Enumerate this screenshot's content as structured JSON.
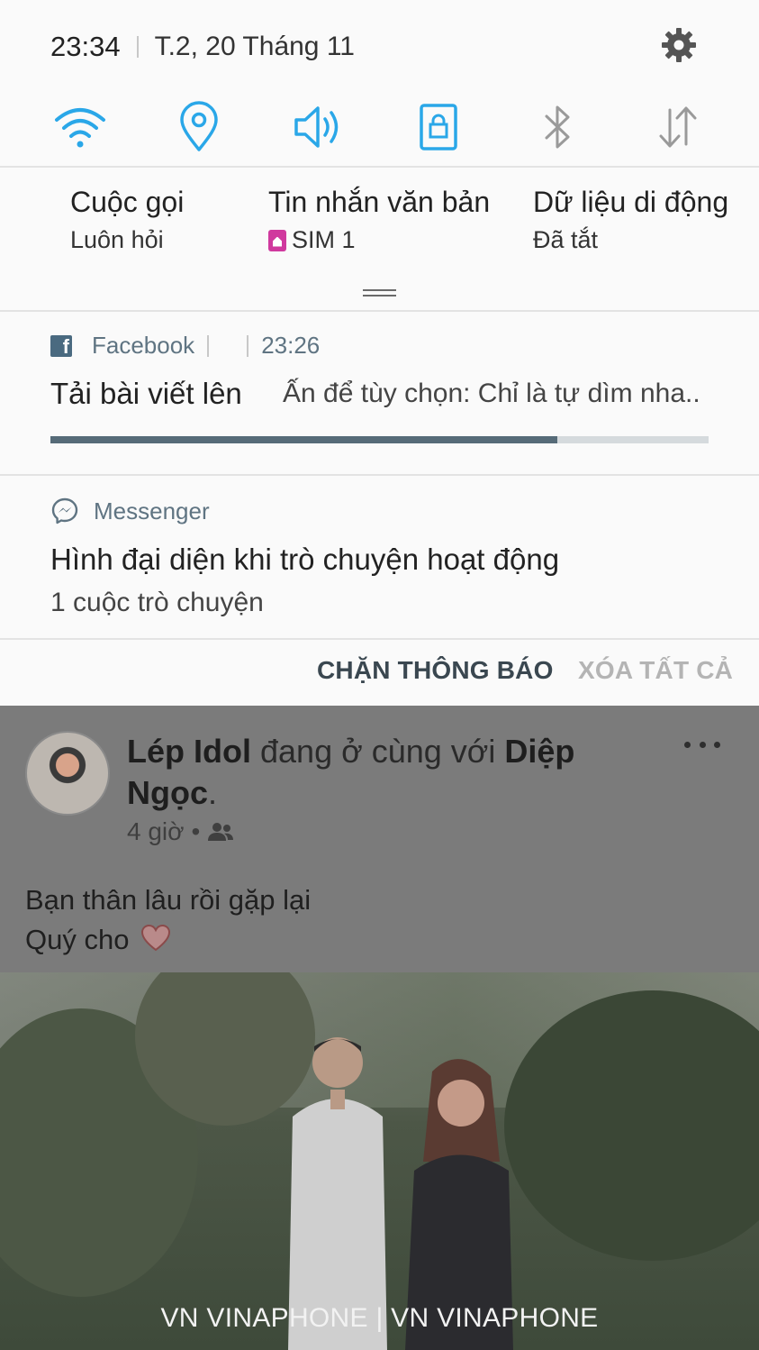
{
  "status": {
    "time": "23:34",
    "date": "T.2, 20 Tháng 11"
  },
  "quick_toggles": [
    {
      "name": "wifi",
      "icon": "wifi-icon",
      "state": "on"
    },
    {
      "name": "location",
      "icon": "location-pin-icon",
      "state": "on"
    },
    {
      "name": "sound",
      "icon": "speaker-icon",
      "state": "on"
    },
    {
      "name": "screen-rotation-lock",
      "icon": "lock-screen-icon",
      "state": "on"
    },
    {
      "name": "bluetooth",
      "icon": "bluetooth-icon",
      "state": "off"
    },
    {
      "name": "mobile-data",
      "icon": "data-arrows-icon",
      "state": "off"
    }
  ],
  "sim": {
    "calls": {
      "title": "Cuộc gọi",
      "value": "Luôn hỏi"
    },
    "sms": {
      "title": "Tin nhắn văn bản",
      "value": "SIM 1"
    },
    "data": {
      "title": "Dữ liệu di động",
      "value": "Đã tắt"
    }
  },
  "notifications": {
    "facebook": {
      "app": "Facebook",
      "time": "23:26",
      "title": "Tải bài viết lên",
      "text": "Ấn để tùy chọn: Chỉ là tự dìm nha..",
      "progress": 0.77
    },
    "messenger": {
      "app": "Messenger",
      "title": "Hình đại diện khi trò chuyện hoạt động",
      "text": "1 cuộc trò chuyện"
    }
  },
  "actions": {
    "block": "CHẶN THÔNG BÁO",
    "clear_all": "XÓA TẤT CẢ"
  },
  "post": {
    "author": "Lép Idol",
    "with_text": "đang ở cùng với",
    "tagged": "Diệp Ngọc",
    "period": ".",
    "age": "4 giờ",
    "dot": "•",
    "line1": "Bạn thân lâu rồi gặp lại",
    "line2": "Quý cho"
  },
  "carrier_label": "VN VINAPHONE | VN VINAPHONE",
  "colors": {
    "accent_blue": "#2aa7e8",
    "toggle_off": "#9a9a9a",
    "progress_fill": "#566b78",
    "action_active": "#3a4750",
    "action_inactive": "#b4b4b4"
  }
}
